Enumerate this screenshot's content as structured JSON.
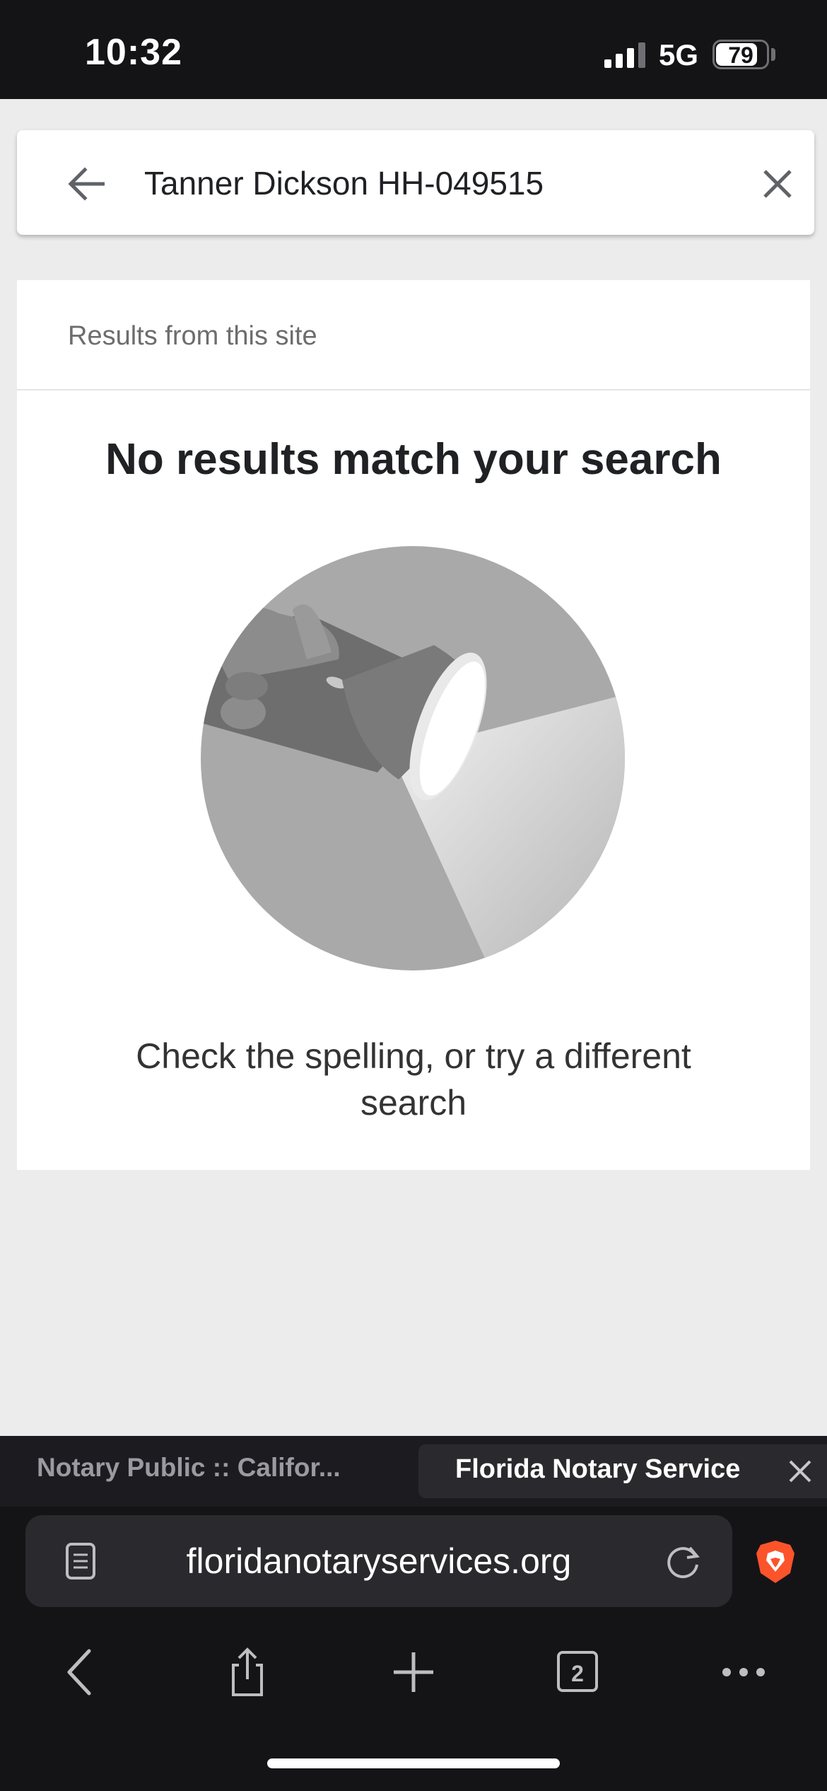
{
  "status_bar": {
    "time": "10:32",
    "network": "5G",
    "battery": "79",
    "battery_level": 0.79
  },
  "search": {
    "query": "Tanner Dickson HH-049515",
    "back_icon": "arrow-left-icon",
    "clear_icon": "close-icon"
  },
  "results": {
    "header": "Results from this site",
    "title": "No results match your search",
    "illustration": "flashlight-illustration",
    "hint": "Check the spelling, or try a different search"
  },
  "browser": {
    "tabs": [
      {
        "label": "Notary Public :: Califor...",
        "active": false
      },
      {
        "label": "Florida Notary Service",
        "active": true
      }
    ],
    "url": "floridanotaryservices.org",
    "tab_count": "2",
    "icons": [
      "reader-mode-icon",
      "reload-icon",
      "brave-shields-icon",
      "back-icon",
      "share-icon",
      "new-tab-icon",
      "tabs-icon",
      "more-icon"
    ]
  },
  "colors": {
    "status_bar_bg": "#141417",
    "page_bg": "#ececec",
    "card_bg": "#ffffff",
    "brave_orange": "#fb542b"
  }
}
